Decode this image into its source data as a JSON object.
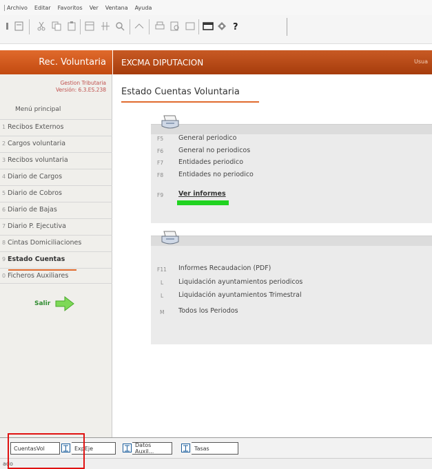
{
  "menubar": [
    "Archivo",
    "Editar",
    "Favoritos",
    "Ver",
    "Ventana",
    "Ayuda"
  ],
  "left_panel": {
    "title": "Rec. Voluntaria",
    "app_name": "Gestion Tributaria",
    "version": "Versión: 6.3.ES.238",
    "menu_title": "Menú principal",
    "items": [
      {
        "num": "1",
        "label": "Recibos Externos"
      },
      {
        "num": "2",
        "label": "Cargos voluntaria"
      },
      {
        "num": "3",
        "label": "Recibos voluntaria"
      },
      {
        "num": "4",
        "label": "Diario de Cargos"
      },
      {
        "num": "5",
        "label": "Diario de Cobros"
      },
      {
        "num": "6",
        "label": "Diario de Bajas"
      },
      {
        "num": "7",
        "label": "Diario P. Ejecutiva"
      },
      {
        "num": "8",
        "label": "Cintas Domiciliaciones"
      },
      {
        "num": "9",
        "label": "Estado Cuentas"
      },
      {
        "num": "0",
        "label": "Ficheros Auxiliares"
      }
    ],
    "active_item": "Estado Cuentas",
    "exit_label": "Salir"
  },
  "main": {
    "header": "EXCMA DIPUTACION",
    "user_label": "Usua",
    "page_title": "Estado Cuentas Voluntaria",
    "group1": [
      {
        "key": "F5",
        "label": "General periodico"
      },
      {
        "key": "F6",
        "label": "General no periodicos"
      },
      {
        "key": "F7",
        "label": "Entidades periodico"
      },
      {
        "key": "F8",
        "label": "Entidades no periodico"
      },
      {
        "key": "F9",
        "label": "Ver informes"
      }
    ],
    "group2": [
      {
        "key": "F11",
        "label": "Informes Recaudacion (PDF)"
      },
      {
        "key": "L",
        "label": "Liquidación ayuntamientos periodicos"
      },
      {
        "key": "L",
        "label": "Liquidación ayuntamientos Trimestral"
      },
      {
        "key": "M",
        "label": "Todos los Periodos"
      }
    ]
  },
  "tabs": [
    "CuentasVol",
    "ExpEje",
    "Datos Auxil...",
    "Tasas"
  ],
  "status": "ado"
}
